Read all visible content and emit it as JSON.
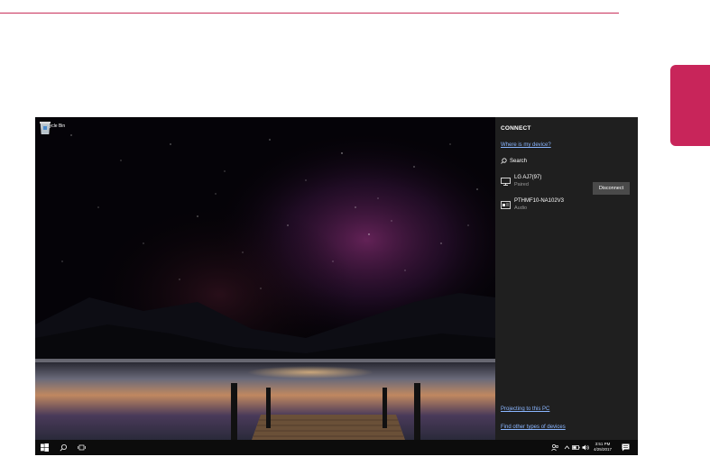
{
  "desktop": {
    "recycle_bin_label": "Recycle Bin"
  },
  "connect_panel": {
    "title": "CONNECT",
    "where_link": "Where is my device?",
    "search_label": "Search",
    "devices": [
      {
        "name": "LG AJ7(97)",
        "status": "Paired",
        "icon": "monitor-icon"
      },
      {
        "name": "PTHMF10-NA102V3",
        "status": "Audio",
        "icon": "audio-device-icon"
      }
    ],
    "disconnect_label": "Disconnect",
    "projecting_link": "Projecting to this PC",
    "find_other_link": "Find other types of devices"
  },
  "taskbar": {
    "time": "3:51 PM",
    "date": "4/25/2017"
  },
  "colors": {
    "accent": "#c8255a",
    "panel_bg": "#1f1f1f",
    "link": "#8ab6ff"
  }
}
